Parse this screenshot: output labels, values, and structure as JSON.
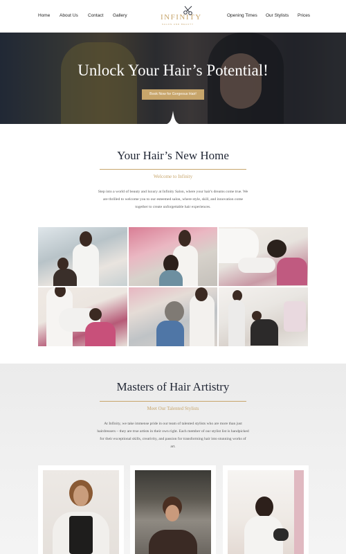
{
  "nav": {
    "left_links": [
      "Home",
      "About Us",
      "Contact",
      "Gallery"
    ],
    "right_links": [
      "Opening Times",
      "Our Stylists",
      "Prices"
    ],
    "logo_word": "INFINITY",
    "logo_tagline": "SALON AND BEAUTY",
    "logo_icon": "scissors-icon"
  },
  "hero": {
    "headline": "Unlock Your Hair’s Potential!",
    "cta_label": "Book Now for Gorgeous Hair!"
  },
  "welcome": {
    "title": "Your Hair’s New Home",
    "subtitle": "Welcome to Infinity",
    "body": "Step into a world of beauty and luxury at Infinity Salon, where your hair's dreams come true. We are thrilled to welcome you to our esteemed salon, where style, skill, and innovation come together to create unforgettable hair experiences."
  },
  "stylists": {
    "title": "Masters of Hair Artistry",
    "subtitle": "Meet Our Talented Stylists",
    "body": "At Infinity, we take immense pride in our team of talented stylists who are more than just hairdressers – they are true artists in their own right. Each member of our stylist list is handpicked for their exceptional skills, creativity, and passion for transforming hair into stunning works of art."
  },
  "colors": {
    "accent_gold": "#c7a56b",
    "heading_navy": "#1f2533",
    "section_gray": "#ebebeb"
  }
}
